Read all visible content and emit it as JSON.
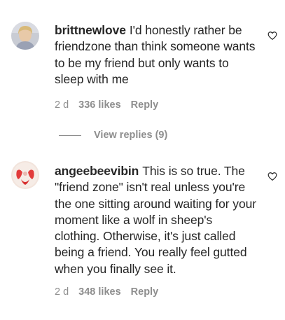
{
  "comments": [
    {
      "username": "brittnewlove",
      "text": "I'd honestly rather be friendzone than think someone wants to be my friend but only wants to sleep with me",
      "time": "2 d",
      "likes": "336 likes",
      "reply_label": "Reply",
      "avatar_icon": "profile-photo-avatar",
      "like_icon": "heart-outline-icon"
    },
    {
      "username": "angeebeevibin",
      "text": "This is so true. The \"friend zone\" isn't real unless you're the one sitting around waiting for your moment like a wolf in sheep's clothing. Otherwise, it's just called being a friend. You really feel gutted when you finally see it.",
      "time": "2 d",
      "likes": "348 likes",
      "reply_label": "Reply",
      "avatar_icon": "profile-photo-avatar",
      "like_icon": "heart-outline-icon"
    }
  ],
  "view_replies": {
    "label": "View replies (9)"
  },
  "colors": {
    "text": "#262626",
    "secondary": "#8e8e8e",
    "background": "#ffffff"
  }
}
